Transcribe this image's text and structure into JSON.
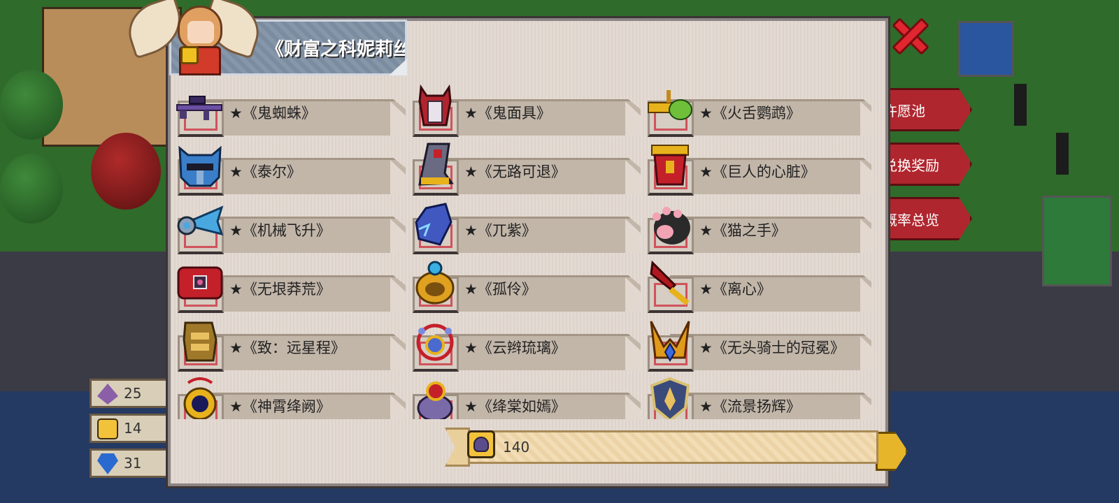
{
  "dialog": {
    "title": "《财富之科妮莉丝》"
  },
  "items": [
    [
      {
        "name": "★《鬼蜘蛛》",
        "icon": "sniper-rifle-icon",
        "color": "#6b4fa3"
      },
      {
        "name": "★《鬼面具》",
        "icon": "demon-mask-icon",
        "color": "#b0242e"
      },
      {
        "name": "★《火舌鹦鹉》",
        "icon": "parrot-gun-icon",
        "color": "#e8b21c"
      }
    ],
    [
      {
        "name": "★《泰尔》",
        "icon": "knight-helmet-icon",
        "color": "#3a7ec9"
      },
      {
        "name": "★《无路可退》",
        "icon": "armored-boot-icon",
        "color": "#6a6a82"
      },
      {
        "name": "★《巨人的心脏》",
        "icon": "red-armor-icon",
        "color": "#c4202a"
      }
    ],
    [
      {
        "name": "★《机械飞升》",
        "icon": "mech-wing-icon",
        "color": "#4aa8e0"
      },
      {
        "name": "★《兀紫》",
        "icon": "purple-gauntlet-icon",
        "color": "#4058c0"
      },
      {
        "name": "★《猫之手》",
        "icon": "cat-paw-icon",
        "color": "#2a2a2a"
      }
    ],
    [
      {
        "name": "★《无垠莽荒》",
        "icon": "red-belt-icon",
        "color": "#c4202a"
      },
      {
        "name": "★《孤伶》",
        "icon": "gold-ring-icon",
        "color": "#e0a020"
      },
      {
        "name": "★《离心》",
        "icon": "red-dagger-icon",
        "color": "#b0181e"
      }
    ],
    [
      {
        "name": "★《致：远星程》",
        "icon": "golden-gauntlet-icon",
        "color": "#a0782a"
      },
      {
        "name": "★《云辫琉璃》",
        "icon": "orb-necklace-icon",
        "color": "#4a6ad0"
      },
      {
        "name": "★《无头骑士的冠冕》",
        "icon": "horned-crown-icon",
        "color": "#e09a1c"
      }
    ],
    [
      {
        "name": "★《神霄绛阙》",
        "icon": "dark-orb-amulet-icon",
        "color": "#1a1a5a"
      },
      {
        "name": "★《绛棠如嫣》",
        "icon": "ruby-ring-icon",
        "color": "#c4202a"
      },
      {
        "name": "★《流景扬辉》",
        "icon": "shield-crest-icon",
        "color": "#3a4a7a"
      }
    ]
  ],
  "counter": {
    "value": "140"
  },
  "background": {
    "side_buttons": [
      "许愿池",
      "兑换奖励",
      "概率总览"
    ],
    "resources": [
      {
        "value": "25",
        "icon": "crystal-icon"
      },
      {
        "value": "14",
        "icon": "coin-icon"
      },
      {
        "value": "31",
        "icon": "gem-icon"
      }
    ]
  }
}
